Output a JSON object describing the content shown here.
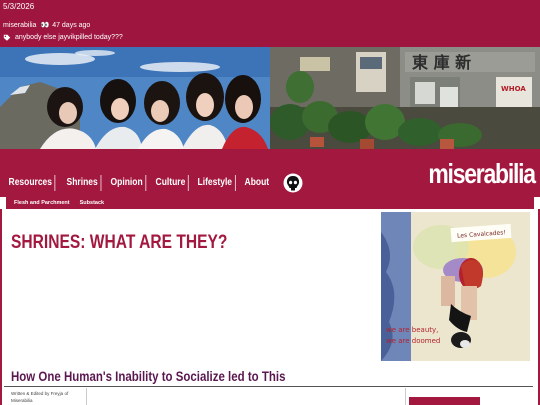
{
  "topbar": {
    "date": "5/3/2026",
    "status_user": "miserabilia",
    "status_eyes": "👀",
    "status_time": "47 days ago",
    "post_text": "anybody else jayvikpilled today???"
  },
  "nav": {
    "items": [
      "Resources",
      "Shrines",
      "Opinion",
      "Culture",
      "Lifestyle",
      "About"
    ],
    "site_title": "miserabilia"
  },
  "subnav": {
    "items": [
      "Flesh and Parchment",
      "Substack"
    ]
  },
  "article": {
    "title": "SHRINES: WHAT ARE THEY?",
    "subtitle": "How One Human's Inability to Socialize led to This",
    "byline": "Written & Edited by Freyja of Miserabilia"
  },
  "art": {
    "note": "Les Cavalcades!",
    "caption_line1": "we are beauty,",
    "caption_line2": "we are doomed"
  },
  "colors": {
    "brand": "#a3183f",
    "topbar": "#9e1640",
    "subtitle": "#5b1850"
  },
  "icons": {
    "tag": "tag-icon",
    "logo": "skull-logo-icon"
  }
}
